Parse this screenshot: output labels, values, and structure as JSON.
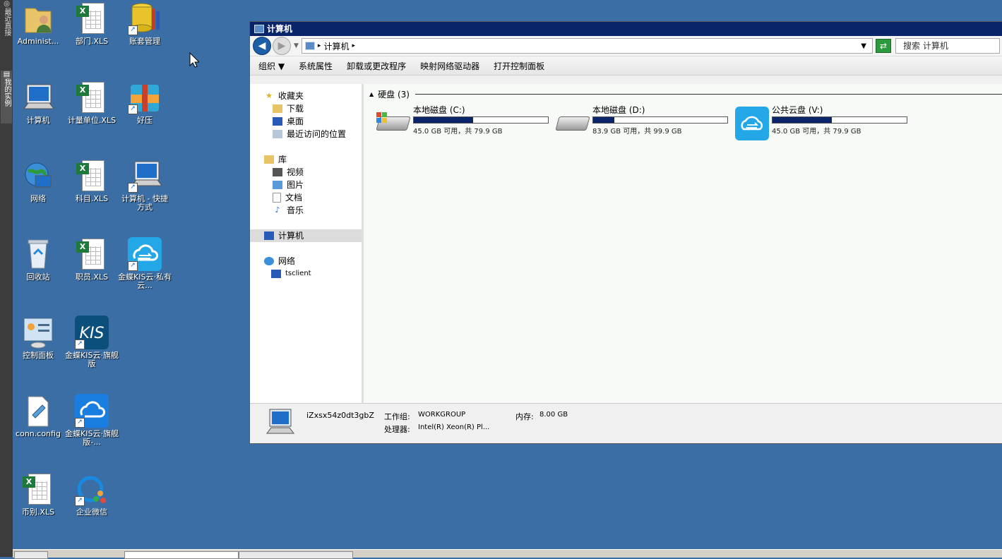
{
  "desktop": {
    "icons": [
      {
        "label": "Administ..."
      },
      {
        "label": "部门.XLS"
      },
      {
        "label": "账套管理"
      },
      {
        "label": "计算机"
      },
      {
        "label": "计量单位.XLS"
      },
      {
        "label": "好压"
      },
      {
        "label": "网络"
      },
      {
        "label": "科目.XLS"
      },
      {
        "label": "计算机 - 快捷方式"
      },
      {
        "label": "回收站"
      },
      {
        "label": "职员.XLS"
      },
      {
        "label": "金蝶KIS云·私有云..."
      },
      {
        "label": "控制面板"
      },
      {
        "label": "金蝶KIS云·旗舰版"
      },
      {
        "label": "conn.config"
      },
      {
        "label": "金蝶KIS云·旗舰版-..."
      },
      {
        "label": "币别.XLS"
      },
      {
        "label": "企业微信"
      }
    ],
    "side_strip": {
      "label1": "◎最近直接",
      "label2": "▤我的实例"
    }
  },
  "window": {
    "title": "计算机",
    "address": "计算机",
    "search_placeholder": "搜索 计算机",
    "toolbar": [
      "组织 ▼",
      "系统属性",
      "卸载或更改程序",
      "映射网络驱动器",
      "打开控制面板"
    ],
    "nav": {
      "favorites": "收藏夹",
      "fav_items": [
        "下载",
        "桌面",
        "最近访问的位置"
      ],
      "libraries": "库",
      "lib_items": [
        "视频",
        "图片",
        "文档",
        "音乐"
      ],
      "computer": "计算机",
      "network": "网络",
      "net_items": [
        "tsclient"
      ]
    },
    "group_header": "硬盘 (3)",
    "drives": [
      {
        "name": "本地磁盘 (C:)",
        "info": "45.0 GB 可用，共 79.9 GB",
        "used_fraction": 0.44
      },
      {
        "name": "本地磁盘 (D:)",
        "info": "83.9 GB 可用，共 99.9 GB",
        "used_fraction": 0.16
      },
      {
        "name": "公共云盘 (V:)",
        "info": "45.0 GB 可用，共 79.9 GB",
        "used_fraction": 0.44
      }
    ],
    "details": {
      "computer_name": "iZxsx54z0dt3gbZ",
      "workgroup_label": "工作组:",
      "workgroup": "WORKGROUP",
      "memory_label": "内存:",
      "memory": "8.00 GB",
      "cpu_label": "处理器:",
      "cpu": "Intel(R) Xeon(R) Pl..."
    }
  },
  "colors": {
    "desktop": "#3a6ea5",
    "titlebar": "#0a246a",
    "bar_fill": "#0a246a"
  }
}
